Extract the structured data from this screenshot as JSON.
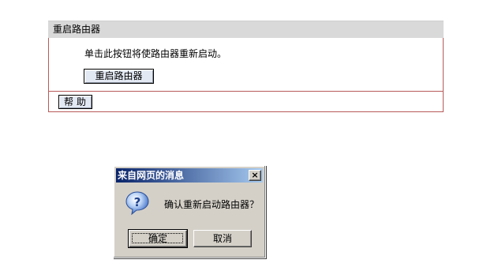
{
  "panel": {
    "title": "重启路由器",
    "description": "单击此按钮将使路由器重新启动。",
    "reboot_button": "重启路由器",
    "help_button": "帮助"
  },
  "dialog": {
    "title": "来自网页的消息",
    "close_glyph": "×",
    "message": "确认重新启动路由器？",
    "icon": "question-icon",
    "ok_label": "确定",
    "cancel_label": "取消"
  }
}
